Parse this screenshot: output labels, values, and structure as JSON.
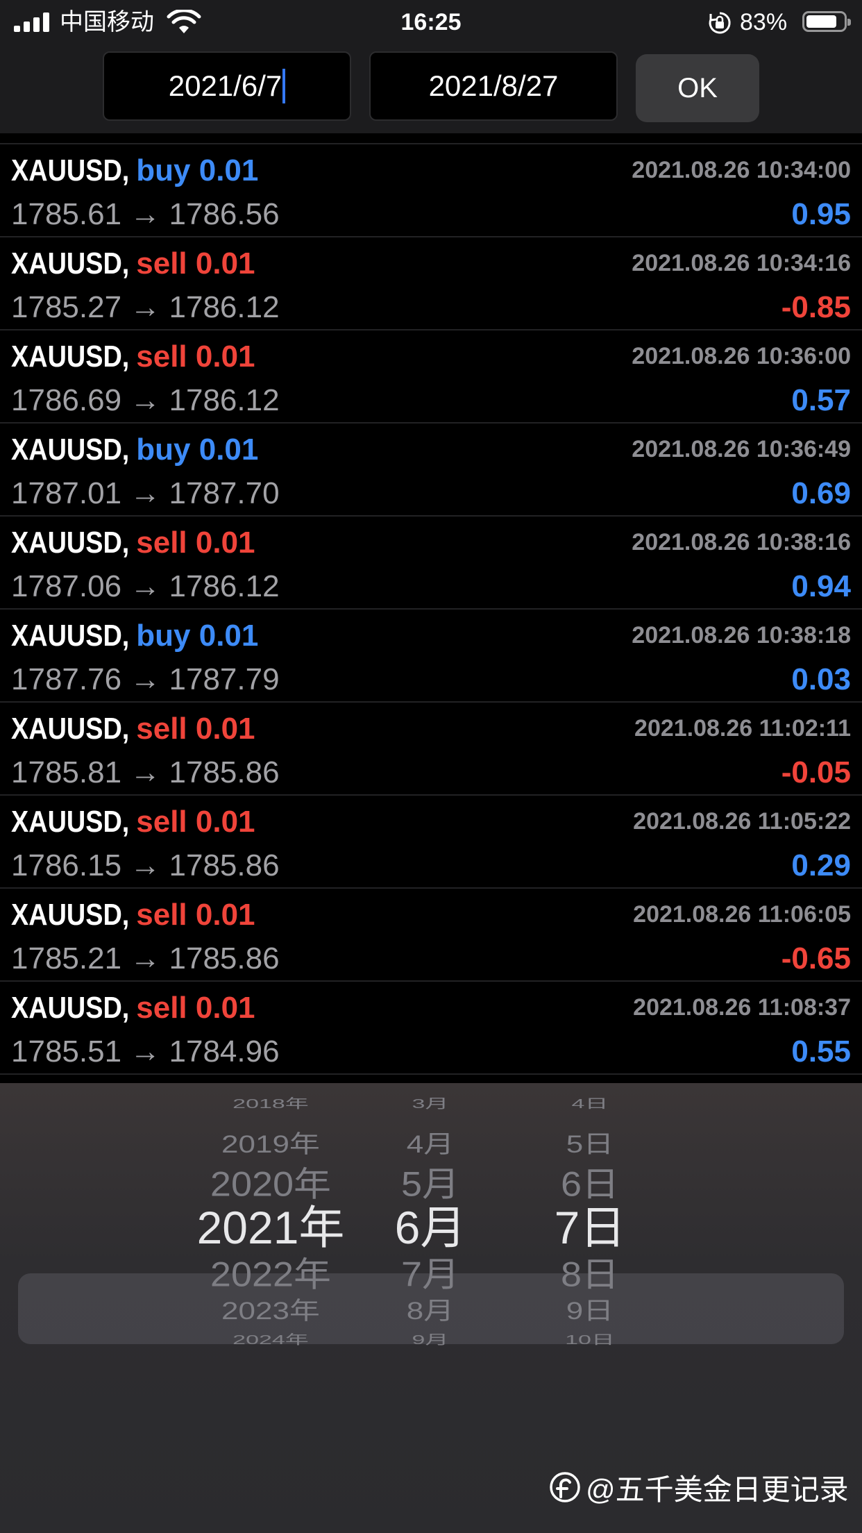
{
  "status_bar": {
    "carrier": "中国移动",
    "time": "16:25",
    "battery_percent": "83%",
    "battery_level": 0.83
  },
  "date_range": {
    "from": "2021/6/7",
    "to": "2021/8/27",
    "ok_label": "OK"
  },
  "trades": [
    {
      "symbol": "XAUUSD,",
      "side": "buy",
      "volume": "0.01",
      "time": "2021.08.26 10:34:00",
      "prices": "1785.61 → 1786.56",
      "profit": "0.95"
    },
    {
      "symbol": "XAUUSD,",
      "side": "sell",
      "volume": "0.01",
      "time": "2021.08.26 10:34:16",
      "prices": "1785.27 → 1786.12",
      "profit": "-0.85"
    },
    {
      "symbol": "XAUUSD,",
      "side": "sell",
      "volume": "0.01",
      "time": "2021.08.26 10:36:00",
      "prices": "1786.69 → 1786.12",
      "profit": "0.57"
    },
    {
      "symbol": "XAUUSD,",
      "side": "buy",
      "volume": "0.01",
      "time": "2021.08.26 10:36:49",
      "prices": "1787.01 → 1787.70",
      "profit": "0.69"
    },
    {
      "symbol": "XAUUSD,",
      "side": "sell",
      "volume": "0.01",
      "time": "2021.08.26 10:38:16",
      "prices": "1787.06 → 1786.12",
      "profit": "0.94"
    },
    {
      "symbol": "XAUUSD,",
      "side": "buy",
      "volume": "0.01",
      "time": "2021.08.26 10:38:18",
      "prices": "1787.76 → 1787.79",
      "profit": "0.03"
    },
    {
      "symbol": "XAUUSD,",
      "side": "sell",
      "volume": "0.01",
      "time": "2021.08.26 11:02:11",
      "prices": "1785.81 → 1785.86",
      "profit": "-0.05"
    },
    {
      "symbol": "XAUUSD,",
      "side": "sell",
      "volume": "0.01",
      "time": "2021.08.26 11:05:22",
      "prices": "1786.15 → 1785.86",
      "profit": "0.29"
    },
    {
      "symbol": "XAUUSD,",
      "side": "sell",
      "volume": "0.01",
      "time": "2021.08.26 11:06:05",
      "prices": "1785.21 → 1785.86",
      "profit": "-0.65"
    },
    {
      "symbol": "XAUUSD,",
      "side": "sell",
      "volume": "0.01",
      "time": "2021.08.26 11:08:37",
      "prices": "1785.51 → 1784.96",
      "profit": "0.55"
    }
  ],
  "picker": {
    "years": [
      "2018年",
      "2019年",
      "2020年",
      "2021年",
      "2022年",
      "2023年",
      "2024年"
    ],
    "months": [
      "3月",
      "4月",
      "5月",
      "6月",
      "7月",
      "8月",
      "9月"
    ],
    "days": [
      "4日",
      "5日",
      "6日",
      "7日",
      "8日",
      "9日",
      "10日"
    ],
    "selected_index": 3
  },
  "watermark": "@五千美金日更记录",
  "colors": {
    "buy": "#3d8bf7",
    "sell": "#f0443a",
    "caret": "#3478f6"
  }
}
